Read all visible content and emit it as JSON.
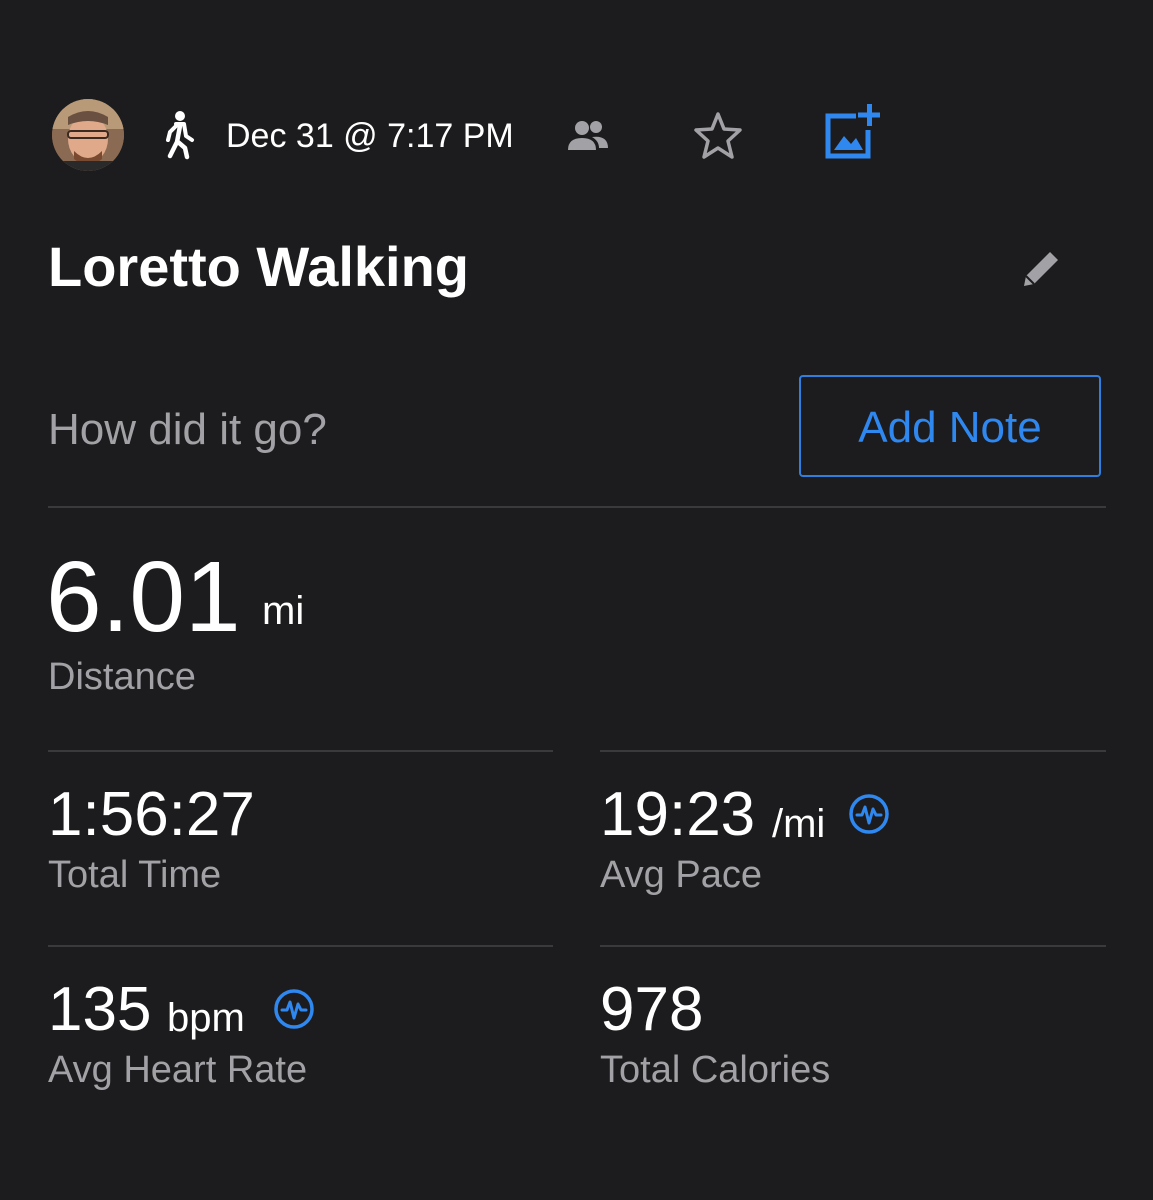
{
  "header": {
    "date_time": "Dec 31 @ 7:17 PM",
    "activity_icon": "walking-person-icon",
    "people_icon": "people-icon",
    "favorite_icon": "star-outline-icon",
    "add_photo_icon": "add-photo-icon"
  },
  "activity": {
    "title": "Loretto Walking",
    "edit_icon": "pencil-icon"
  },
  "note": {
    "prompt": "How did it go?",
    "button_label": "Add Note"
  },
  "distance": {
    "value": "6.01",
    "unit": "mi",
    "label": "Distance"
  },
  "stats": {
    "total_time": {
      "value": "1:56:27",
      "label": "Total Time"
    },
    "avg_pace": {
      "value": "19:23",
      "unit": "/mi",
      "label": "Avg Pace",
      "icon": "heart-rate-monitor-icon"
    },
    "avg_heart_rate": {
      "value": "135",
      "unit": "bpm",
      "label": "Avg Heart Rate",
      "icon": "heart-rate-monitor-icon"
    },
    "total_calories": {
      "value": "978",
      "label": "Total Calories"
    }
  },
  "colors": {
    "background": "#1c1c1e",
    "accent_blue": "#2f87f0",
    "secondary_text": "#a2a2a6",
    "divider": "#3a3a3c"
  }
}
